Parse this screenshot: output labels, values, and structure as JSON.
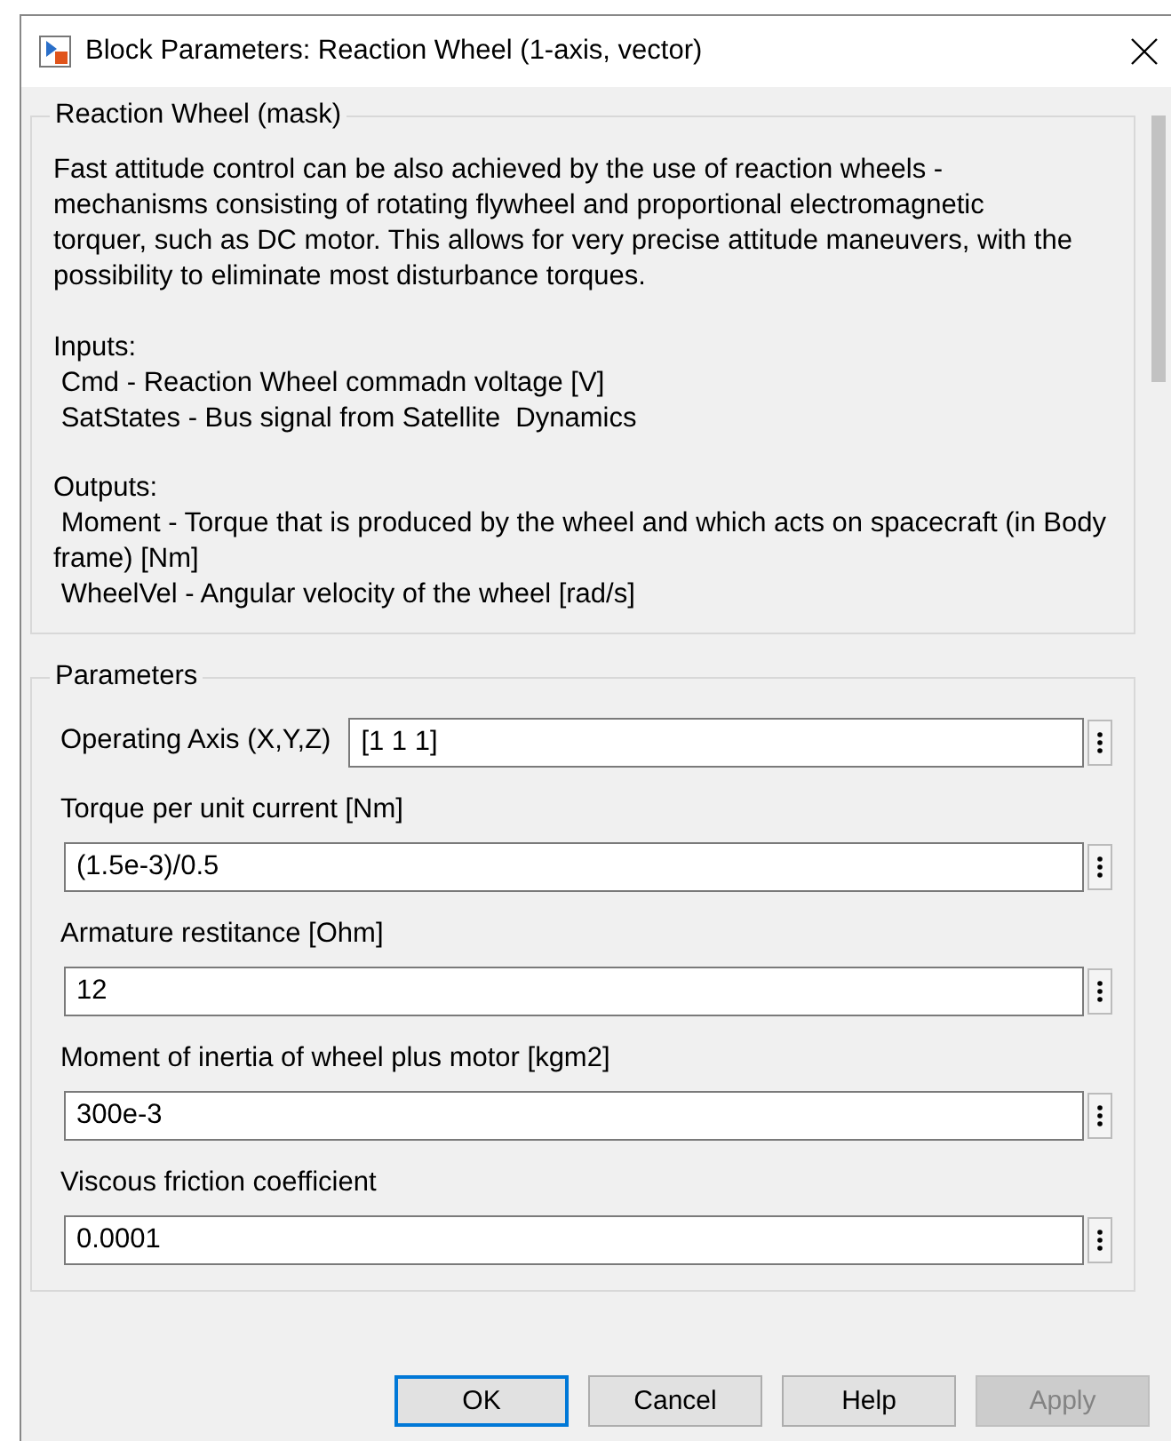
{
  "window": {
    "title": "Block Parameters: Reaction Wheel (1-axis, vector)"
  },
  "mask": {
    "title": "Reaction Wheel (mask)",
    "description": "Fast attitude control can be also achieved by the use of reaction wheels - mechanisms consisting of rotating flywheel and proportional electromagnetic torquer, such as DC motor. This allows for very precise attitude maneuvers, with the possibility to eliminate most disturbance torques.",
    "sections": [
      {
        "heading": "Inputs:",
        "lines": [
          " Cmd - Reaction Wheel commadn voltage [V]",
          " SatStates - Bus signal from Satellite  Dynamics"
        ]
      },
      {
        "heading": "Outputs:",
        "lines": [
          " Moment - Torque that is produced by the wheel and which acts on spacecraft (in Body frame) [Nm]",
          " WheelVel - Angular velocity of the wheel [rad/s]"
        ]
      }
    ]
  },
  "parameters": {
    "title": "Parameters",
    "items": [
      {
        "kind": "inline",
        "label": "Operating Axis (X,Y,Z)",
        "value": "[1 1 1]"
      },
      {
        "kind": "stacked",
        "label": "Torque per unit current [Nm]",
        "value": "(1.5e-3)/0.5"
      },
      {
        "kind": "stacked",
        "label": "Armature restitance [Ohm]",
        "value": "12"
      },
      {
        "kind": "stacked",
        "label": "Moment of inertia of wheel plus motor [kgm2]",
        "value": "300e-3"
      },
      {
        "kind": "stacked",
        "label": "Viscous friction coefficient",
        "value": "0.0001"
      }
    ]
  },
  "buttons": [
    {
      "label": "OK",
      "default": true,
      "disabled": false
    },
    {
      "label": "Cancel",
      "default": false,
      "disabled": false
    },
    {
      "label": "Help",
      "default": false,
      "disabled": false
    },
    {
      "label": "Apply",
      "default": false,
      "disabled": true
    }
  ]
}
